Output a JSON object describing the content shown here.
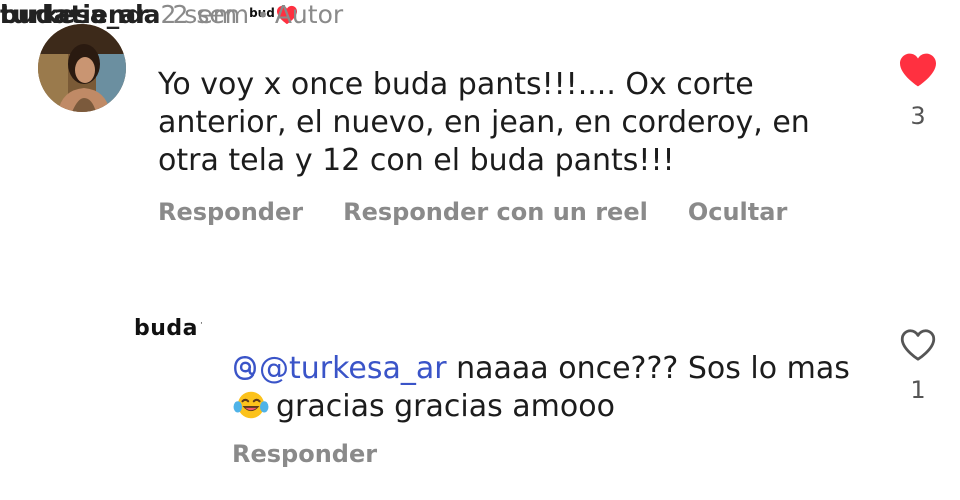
{
  "comment_1": {
    "username": "turkesa_ar",
    "time": "2 sem",
    "badge_text": "bud",
    "text": "Yo voy x once buda pants!!!.... Ox corte anterior, el nuevo, en jean, en corderoy, en otra tela y 12 con el buda pants!!!",
    "actions": {
      "reply": "Responder",
      "reply_reel": "Responder con un reel",
      "hide": "Ocultar"
    },
    "like_count": "3",
    "liked": true
  },
  "comment_2": {
    "avatar_logo": "buda",
    "username": "budatienda",
    "time": "2 sem",
    "separator": "•",
    "author_label": "Autor",
    "mention": "@turkesa_ar",
    "text_after_mention": " naaaa once??? Sos lo mas",
    "text_line2": "gracias gracias amooo",
    "emoji": "face-with-tears-of-joy",
    "actions": {
      "reply": "Responder"
    },
    "like_count": "1",
    "liked": false
  },
  "colors": {
    "heart_red": "#ff3040",
    "mention_blue": "#3a54c8",
    "muted_gray": "#8a8a8a"
  }
}
